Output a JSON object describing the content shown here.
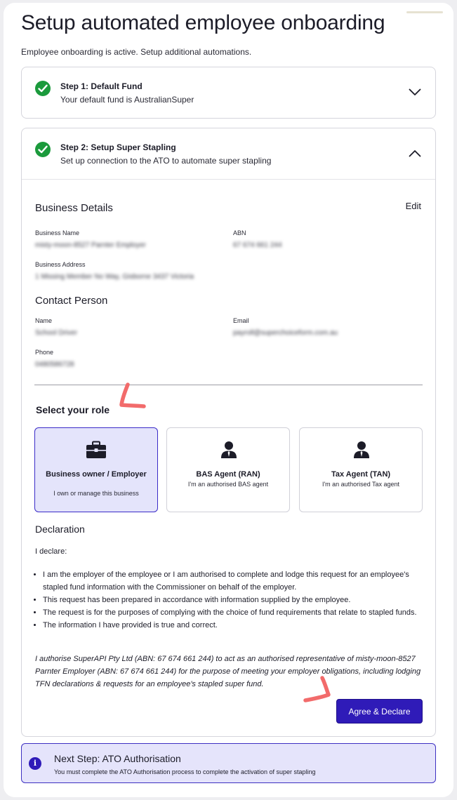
{
  "page": {
    "title": "Setup automated employee onboarding",
    "subtitle": "Employee onboarding is active. Setup additional automations."
  },
  "step1": {
    "title": "Step 1: Default Fund",
    "description": "Your default fund is AustralianSuper",
    "icon": "check-circle-icon",
    "toggle_icon": "chevron-down-icon"
  },
  "step2": {
    "title": "Step 2: Setup Super Stapling",
    "description": "Set up connection to the ATO to automate super stapling",
    "icon": "check-circle-icon",
    "toggle_icon": "chevron-up-icon"
  },
  "business": {
    "heading": "Business Details",
    "edit_label": "Edit",
    "name_label": "Business Name",
    "name_value": "misty-moon-8527 Parnter Employer",
    "abn_label": "ABN",
    "abn_value": "67 674 661 244",
    "address_label": "Business Address",
    "address_value": "1 Missing Member No Way, Gisborne 3437 Victoria"
  },
  "contact": {
    "heading": "Contact Person",
    "name_label": "Name",
    "name_value": "School Driver",
    "email_label": "Email",
    "email_value": "payroll@superchoiceform.com.au",
    "phone_label": "Phone",
    "phone_value": "0480586728"
  },
  "roles": {
    "heading": "Select your role",
    "options": [
      {
        "title": "Business owner / Employer",
        "subtitle": "I own or manage this business",
        "icon": "briefcase-icon",
        "selected": true
      },
      {
        "title": "BAS Agent (RAN)",
        "subtitle": "I'm an authorised BAS agent",
        "icon": "person-icon",
        "selected": false
      },
      {
        "title": "Tax Agent (TAN)",
        "subtitle": "I'm an authorised Tax agent",
        "icon": "person-icon",
        "selected": false
      }
    ]
  },
  "declaration": {
    "heading": "Declaration",
    "intro": "I declare:",
    "items": [
      "I am the employer of the employee or I am authorised to complete and lodge this request for an employee's stapled fund information with the Commissioner on behalf of the employer.",
      "This request has been prepared in accordance with information supplied by the employee.",
      "The request is for the purposes of complying with the choice of fund requirements that relate to stapled funds.",
      "The information I have provided is true and correct."
    ],
    "authorisation": "I authorise SuperAPI Pty Ltd (ABN: 67 674 661 244) to act as an authorised representative of misty-moon-8527 Parnter Employer (ABN: 67 674 661 244) for the purpose of meeting your employer obligations, including lodging TFN declarations & requests for an employee's stapled super fund.",
    "button_label": "Agree & Declare"
  },
  "next_step": {
    "icon": "info-icon",
    "info_glyph": "i",
    "title": "Next Step: ATO Authorisation",
    "description": "You must complete the ATO Authorisation process to complete the activation of super stapling"
  },
  "colors": {
    "accent": "#2f1bb8",
    "success": "#1b9a3c",
    "selected_bg": "#e4e4fb",
    "annotation": "#f26b6b"
  }
}
